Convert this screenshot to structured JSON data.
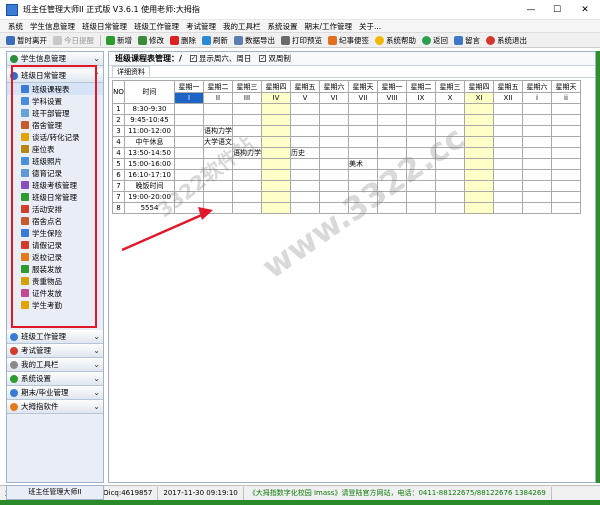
{
  "window": {
    "title": "班主任管理大师II 正式版 V3.6.1  使用老师:大拇指",
    "min": "—",
    "max": "☐",
    "close": "✕"
  },
  "menu": [
    "系统",
    "学生信息管理",
    "班级日常管理",
    "班级工作管理",
    "考试管理",
    "我的工具栏",
    "系统设置",
    "期末/工作管理",
    "关于..."
  ],
  "toolbar": {
    "lock": "暂时离开",
    "remind": "今日提醒",
    "add": "新增",
    "edit": "修改",
    "delete": "删除",
    "refresh": "刷新",
    "export": "数据导出",
    "print": "打印预览",
    "memo": "纪事便签",
    "help": "系统帮助",
    "back": "返回",
    "feedback": "留言",
    "exit": "系统退出"
  },
  "sidebar": {
    "top_group": "学生信息管理",
    "open_group": "班级日常管理",
    "items": [
      "班级课程表",
      "学科设置",
      "班干部管理",
      "宿舍管理",
      "谈话/转化记录",
      "座位表",
      "班级照片",
      "德育记录",
      "班级考核管理",
      "班级日常管理",
      "活动安排",
      "宿舍点名",
      "学生保险",
      "请假记录",
      "返校记录",
      "服装发放",
      "贵重物品",
      "证件发放",
      "学生考勤"
    ],
    "lower_groups": [
      "班级工作管理",
      "考试管理",
      "我的工具栏",
      "系统设置",
      "期末/毕业管理",
      "大拇指软件"
    ],
    "footer": "班主任管理大师II"
  },
  "main": {
    "title": "班级课程表管理：/",
    "check_weekend": "显示周六、周日",
    "check_double": "双周制",
    "tab": "详细资料",
    "table": {
      "col_no": "NO",
      "col_time": "时间",
      "days": [
        "星期一",
        "星期二",
        "星期三",
        "星期四",
        "星期五",
        "星期六",
        "星期天",
        "星期一",
        "星期二",
        "星期三",
        "星期四",
        "星期五",
        "星期六",
        "星期天"
      ],
      "roman": [
        "I",
        "II",
        "III",
        "IV",
        "V",
        "VI",
        "VII",
        "VIII",
        "IX",
        "X",
        "XI",
        "XII",
        "i",
        "ii"
      ],
      "rows": [
        {
          "no": "1",
          "time": "8:30-9:30",
          "cells": [
            "",
            "",
            "",
            "",
            "",
            "",
            "",
            "",
            "",
            "",
            "",
            "",
            "",
            ""
          ]
        },
        {
          "no": "2",
          "time": "9:45-10:45",
          "cells": [
            "",
            "",
            "",
            "",
            "",
            "",
            "",
            "",
            "",
            "",
            "",
            "",
            "",
            ""
          ]
        },
        {
          "no": "3",
          "time": "11:00-12:00",
          "cells": [
            "",
            "语构力学",
            "",
            "",
            "",
            "",
            "",
            "",
            "",
            "",
            "",
            "",
            "",
            ""
          ]
        },
        {
          "no": "4",
          "time": "中午休息",
          "cells": [
            "",
            "大学语文",
            "",
            "",
            "",
            "",
            "",
            "",
            "",
            "",
            "",
            "",
            "",
            ""
          ]
        },
        {
          "no": "4",
          "time": "13:50-14:50",
          "cells": [
            "",
            "",
            "语构力学",
            "",
            "历史",
            "",
            "",
            "",
            "",
            "",
            "",
            "",
            "",
            ""
          ]
        },
        {
          "no": "5",
          "time": "15:00-16:00",
          "cells": [
            "",
            "",
            "",
            "",
            "",
            "",
            "美术",
            "",
            "",
            "",
            "",
            "",
            "",
            ""
          ]
        },
        {
          "no": "6",
          "time": "16:10-17:10",
          "cells": [
            "",
            "",
            "",
            "",
            "",
            "",
            "",
            "",
            "",
            "",
            "",
            "",
            "",
            ""
          ]
        },
        {
          "no": "7",
          "time": "晚饭时间",
          "cells": [
            "",
            "",
            "",
            "",
            "",
            "",
            "",
            "",
            "",
            "",
            "",
            "",
            "",
            ""
          ]
        },
        {
          "no": "7",
          "time": "19:00-20:00",
          "cells": [
            "",
            "",
            "",
            "",
            "",
            "",
            "",
            "",
            "",
            "",
            "",
            "",
            "",
            ""
          ]
        },
        {
          "no": "8",
          "time": "5554",
          "cells": [
            "",
            "",
            "",
            "",
            "",
            "",
            "",
            "",
            "",
            "",
            "",
            "",
            "",
            ""
          ]
        }
      ]
    }
  },
  "watermark": {
    "big": "www.3322.cc",
    "small": "3322软件站"
  },
  "status": {
    "user": "大拇指",
    "site": "www.dmzsoft.com Oicq:4619857",
    "datetime": "2017-11-30 09:19:10",
    "promo": "《大拇指数字化校园 Imass》请登陆官方网站，电话：0411-88122675/88122676 1384269"
  },
  "colors": {
    "accent_blue": "#1f63c6",
    "highlight_yellow": "#ffffc8",
    "red_box": "#e0182a",
    "arrow_red": "#e0182a"
  }
}
